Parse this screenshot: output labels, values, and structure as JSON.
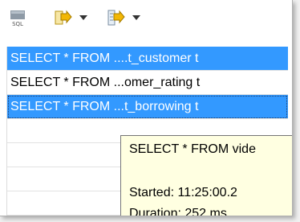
{
  "toolbar": {
    "items": [
      {
        "icon": "sql-editor-icon"
      },
      {
        "icon": "run-query-icon"
      },
      {
        "icon": "chevron-down-icon"
      },
      {
        "icon": "run-script-icon"
      },
      {
        "icon": "chevron-down-icon"
      }
    ]
  },
  "history": {
    "rows": [
      {
        "text": "SELECT * FROM ....t_customer t",
        "selected": true
      },
      {
        "text": "SELECT * FROM ...omer_rating t",
        "selected": false
      },
      {
        "text": "SELECT * FROM ...t_borrowing t",
        "selected": true
      },
      {
        "text": ""
      },
      {
        "text": ""
      },
      {
        "text": ""
      },
      {
        "text": ""
      }
    ]
  },
  "tooltip": {
    "query": "SELECT * FROM vide",
    "started": "Started: 11:25:00.2",
    "duration": "Duration: 252 ms"
  },
  "colors": {
    "selection": "#3399ff",
    "tooltip_bg": "#ffffe1",
    "icon_accent": "#f2b705"
  }
}
